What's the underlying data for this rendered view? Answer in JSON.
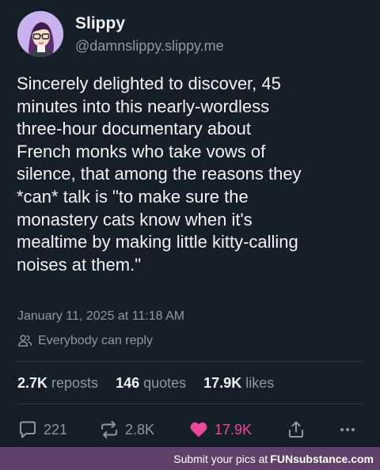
{
  "author": {
    "display_name": "Slippy",
    "handle": "@damnslippy.slippy.me"
  },
  "post": {
    "text": "Sincerely delighted to discover, 45\nminutes into this nearly-wordless\nthree-hour documentary about\nFrench monks who take vows of\nsilence, that among the reasons they\n*can* talk is \"to make sure the\nmonastery cats know when it's\nmealtime by making little kitty-calling\nnoises at them.\"",
    "timestamp": "January 11, 2025 at 11:18 AM",
    "reply_setting": "Everybody can reply"
  },
  "stats": {
    "reposts_count": "2.7K",
    "reposts_label": "reposts",
    "quotes_count": "146",
    "quotes_label": "quotes",
    "likes_count": "17.9K",
    "likes_label": "likes"
  },
  "actions": {
    "reply_count": "221",
    "repost_count": "2.8K",
    "like_count": "17.9K",
    "icons": [
      "reply-icon",
      "repost-icon",
      "heart-icon",
      "share-icon",
      "more-icon"
    ]
  },
  "footer": {
    "text": "Submit your pics at",
    "brand": "FUNsubstance.com"
  },
  "colors": {
    "background": "#161e27",
    "text": "#f1f3f5",
    "muted": "#8d99a6",
    "like": "#ec4899",
    "footer_bar": "#5f4169"
  }
}
